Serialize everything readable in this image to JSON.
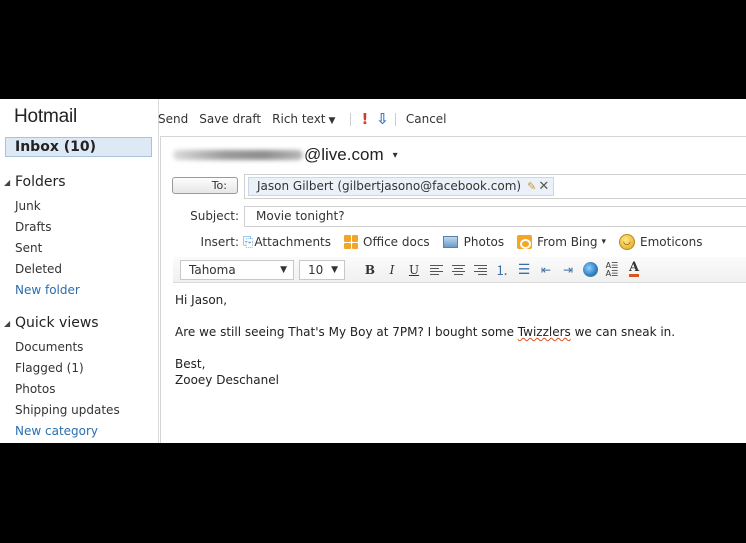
{
  "app": {
    "brand": "Hotmail"
  },
  "sidebar": {
    "inbox": "Inbox (10)",
    "folders": {
      "heading": "Folders",
      "items": [
        "Junk",
        "Drafts",
        "Sent",
        "Deleted"
      ],
      "new_link": "New folder"
    },
    "quick_views": {
      "heading": "Quick views",
      "items": [
        "Documents",
        "Flagged (1)",
        "Photos",
        "Shipping updates"
      ],
      "new_link": "New category"
    }
  },
  "toolbar": {
    "send": "Send",
    "save_draft": "Save draft",
    "rich_text": "Rich text",
    "rich_text_caret": "▼",
    "high_priority_icon": "!",
    "low_priority_icon": "⇩",
    "cancel": "Cancel"
  },
  "compose": {
    "from": {
      "address_suffix": "@live.com",
      "caret": "▾"
    },
    "to": {
      "button_label": "To:",
      "recipient": "Jason Gilbert (gilbertjasono@facebook.com)"
    },
    "subject": {
      "label": "Subject:",
      "value": "Movie tonight?"
    },
    "insert": {
      "label": "Insert:",
      "items": [
        {
          "label": "Attachments",
          "icon": "paperclip-icon"
        },
        {
          "label": "Office docs",
          "icon": "office-docs-icon"
        },
        {
          "label": "Photos",
          "icon": "photo-icon"
        },
        {
          "label": "From Bing",
          "icon": "bing-icon",
          "caret": "▾"
        },
        {
          "label": "Emoticons",
          "icon": "emoticon-icon"
        }
      ]
    },
    "format": {
      "font": "Tahoma",
      "size": "10",
      "dropdown_caret": "▼",
      "bold": "B",
      "italic": "I",
      "underline": "U",
      "font_color_glyph": "A",
      "font_color": "#d9541e"
    },
    "body": {
      "greeting": "Hi Jason,",
      "line_before": "Are we still seeing That's My Boy at 7PM? I bought some ",
      "misspelled": "Twizzlers",
      "line_after": " we can sneak in.",
      "closing": "Best,",
      "signature": "Zooey Deschanel"
    }
  }
}
